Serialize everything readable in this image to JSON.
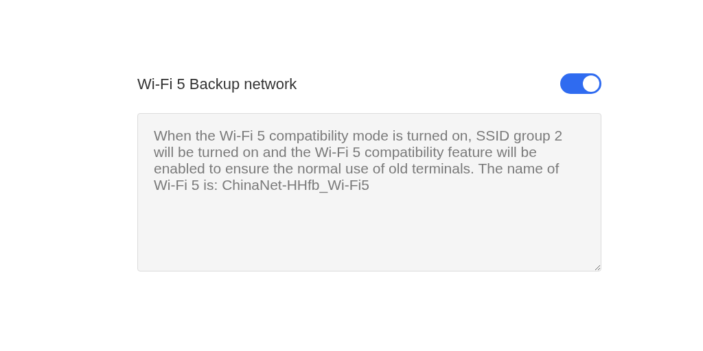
{
  "setting": {
    "label": "Wi-Fi 5 Backup network",
    "on": true
  },
  "description": {
    "value": "When the Wi-Fi 5 compatibility mode is turned on, SSID group 2 will be turned on and the Wi-Fi 5 compatibility feature will be enabled to ensure the normal use of old terminals. The name of Wi-Fi 5 is: ChinaNet-HHfb_Wi-Fi5"
  }
}
